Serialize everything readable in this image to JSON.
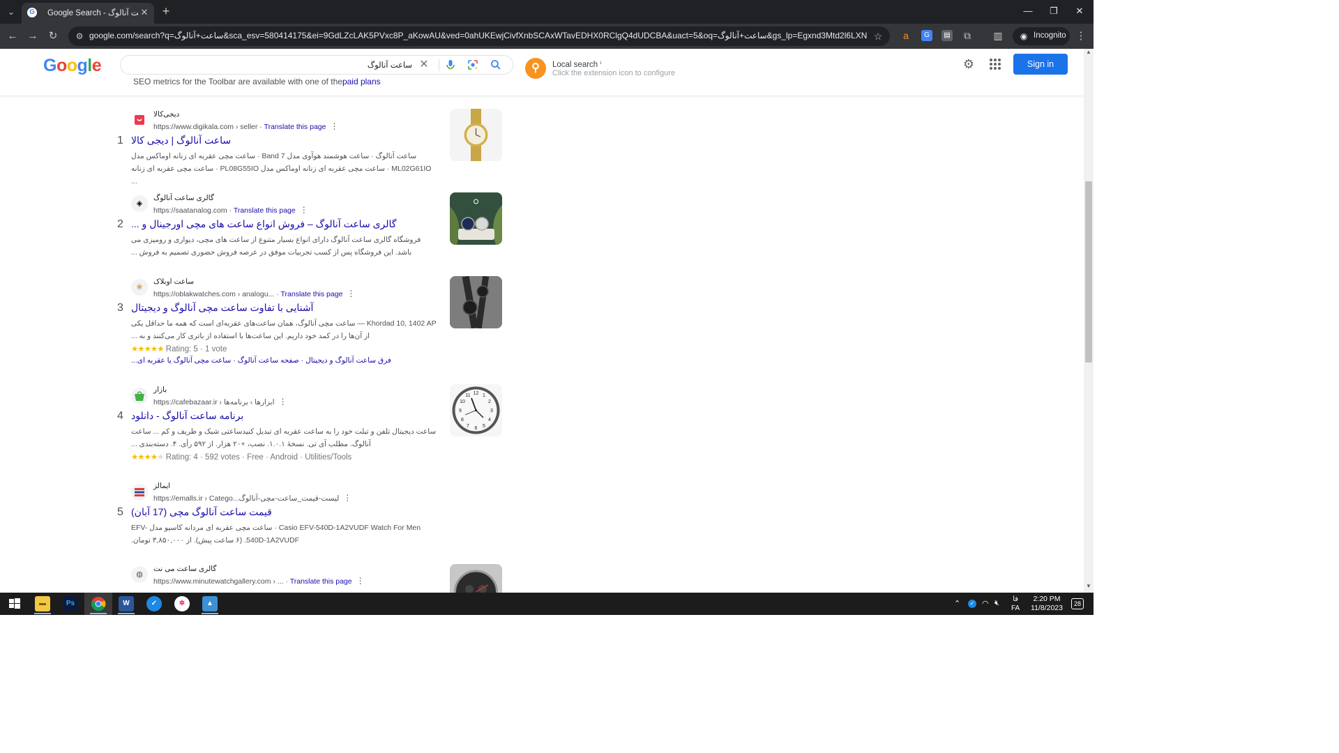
{
  "browser": {
    "tab_title": "Google Search - ساعت آنالوگ",
    "url": "google.com/search?q=ساعت+آنالوگ&sca_esv=580414175&ei=9GdLZcLAK5PVxc8P_aKowAU&ved=0ahUKEwjCivfXnbSCAxWTavEDHX0RClgQ4dUDCBA&uact=5&oq=ساعت+آنالوگ&gs_lp=Egxnd3Mtd2l6LXNlcnAiFdiz2KfY...",
    "incognito_label": "Incognito"
  },
  "google": {
    "logo": [
      "G",
      "o",
      "o",
      "g",
      "l",
      "e"
    ],
    "logo_colors": [
      "#4285f4",
      "#ea4335",
      "#fbbc05",
      "#4285f4",
      "#34a853",
      "#ea4335"
    ],
    "search_query": "ساعت آنالوگ",
    "local_search_title": "Local search",
    "local_search_info": "ⁱ",
    "local_search_sub": "Click the extension icon to configure",
    "sign_in": "Sign in",
    "seo_text": "SEO metrics for the Toolbar are available with one of the",
    "seo_link": "paid plans"
  },
  "results": [
    {
      "num": "1",
      "site_name": "دیجی‌کالا",
      "url": "https://www.digikala.com › seller",
      "translate": "Translate this page",
      "title": "ساعت آنالوگ | دیجی کالا",
      "snippet": "ساعت آنالوگ · ساعت هوشمند هوآوی مدل Band 7 · ساعت مچی عقربه ای زنانه اوماکس مدل ML02G61IO · ساعت مچی عقربه ای زنانه اوماکس مدل PL08G55IO · ساعت مچی عقربه ای زنانه ..."
    },
    {
      "num": "2",
      "site_name": "گالری ساعت آنالوگ",
      "url": "https://saatanalog.com",
      "translate": "Translate this page",
      "title": "گالری ساعت آنالوگ – فروش انواع ساعت های مچی اورجینال و ...",
      "snippet": "فروشگاه گالری ساعت آنالوگ دارای انواع بسیار متنوع از ساعت های مچی، دیواری و رومیزی می باشد. این فروشگاه پس از کسب تجربیات موفق در عرصه فروش حضوری تصمیم به فروش ..."
    },
    {
      "num": "3",
      "site_name": "ساعت اوبلاک",
      "url": "https://oblakwatches.com › analogu...",
      "translate": "Translate this page",
      "title": "آشنایی با تفاوت ساعت مچی آنالوگ و دیجیتال",
      "snippet": "Khordad 10, 1402 AP — ساعت مچی آنالوگ، همان ساعت‌های عقربه‌ای است که همه ما حداقل یکی از آن‌ها را در کمد خود داریم. این ساعت‌ها با استفاده از باتری کار می‌کنند و به ...",
      "rating_stars": 5,
      "rating_text": "Rating: 5 · 1 vote",
      "sitelinks": "فرق ساعت آنالوگ و دیجیتال · صفحه ساعت آنالوگ · ساعت مچی آنالوگ یا عقربه ای..."
    },
    {
      "num": "4",
      "site_name": "بازار",
      "url": "https://cafebazaar.ir › ابزارها › برنامه‌ها",
      "translate": "",
      "title": "برنامه ساعت آنالوگ - دانلود",
      "snippet": "ساعت دیجیتال تلفن و تبلت خود را به ساعت عقربه ای تبدیل کنیدساعتی شیک و ظریف و کم ... ساعت آنالوگ. مطلب آی تی. نسخهٔ ۱.۰.۱. نصب، +۲۰ هزار. از ۵۹۲ رأی. ۴. دسته‌بندی ...",
      "rating_stars": 4,
      "rating_text": "Rating: 4 · 592 votes · Free · Android · Utilities/Tools"
    },
    {
      "num": "5",
      "site_name": "ایمالز",
      "url": "https://emalls.ir › Catego...لیست-قیمت_ساعت-مچی-آنالوگ",
      "translate": "",
      "title": "قیمت ساعت آنالوگ مچی (17 آبان)",
      "snippet": "Casio EFV-540D-1A2VUDF Watch For Men · ساعت مچی عقربه ای مردانه کاسیو مدل EFV-540D-1A2VUDF. (۶ ساعت پیش). از ۳,۸۵۰,۰۰۰ تومان."
    },
    {
      "num": "6",
      "site_name": "گالری ساعت می نت",
      "url": "https://www.minutewatchgallery.com › ...",
      "translate": "Translate this page"
    }
  ],
  "taskbar": {
    "lang": "فا",
    "lang_code": "FA",
    "time": "2:20 PM",
    "date": "11/8/2023",
    "notifications": "28"
  }
}
